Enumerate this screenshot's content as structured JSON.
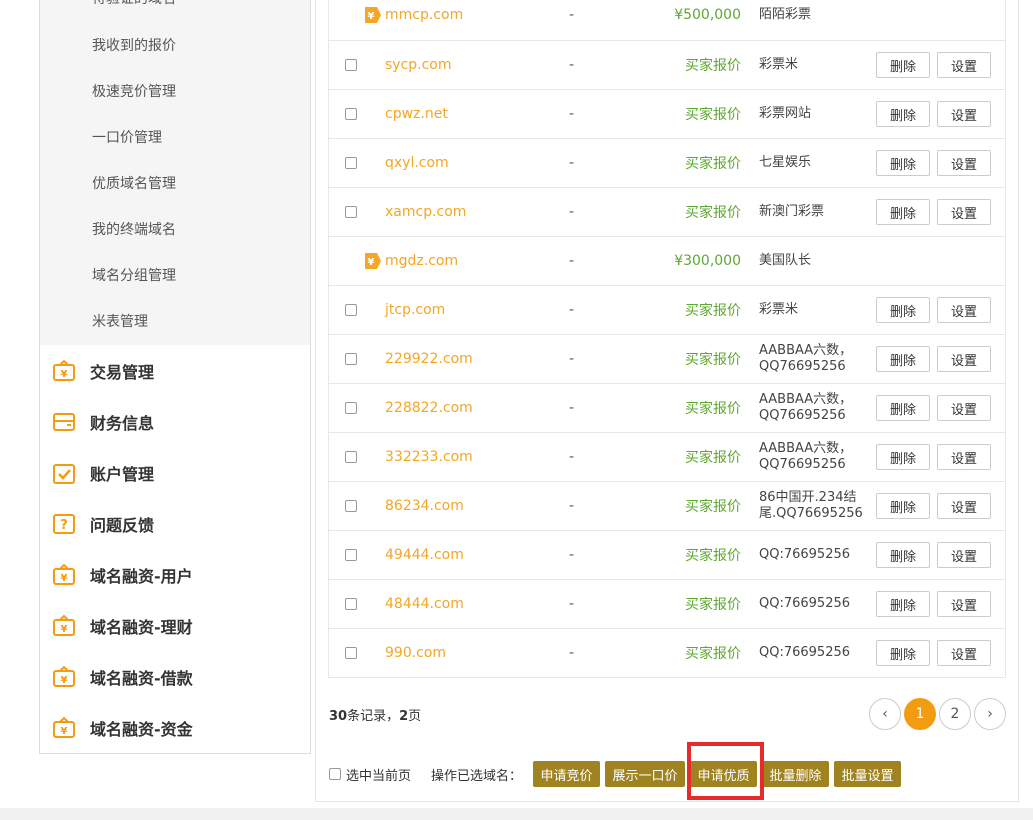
{
  "sidebar": {
    "sub_items": [
      "待验证的域名",
      "我收到的报价",
      "极速竞价管理",
      "一口价管理",
      "优质域名管理",
      "我的终端域名",
      "域名分组管理",
      "米表管理"
    ],
    "main_items": [
      {
        "label": "交易管理",
        "icon": "yen-bag-icon"
      },
      {
        "label": "财务信息",
        "icon": "card-icon"
      },
      {
        "label": "账户管理",
        "icon": "check-box-icon"
      },
      {
        "label": "问题反馈",
        "icon": "question-box-icon"
      },
      {
        "label": "域名融资-用户",
        "icon": "yen-bag-icon"
      },
      {
        "label": "域名融资-理财",
        "icon": "yen-bag-icon"
      },
      {
        "label": "域名融资-借款",
        "icon": "yen-bag-icon"
      },
      {
        "label": "域名融资-资金",
        "icon": "yen-bag-icon"
      }
    ]
  },
  "table": {
    "rows": [
      {
        "domain": "mmcp.com",
        "dash": "-",
        "price": "¥500,000",
        "desc": "陌陌彩票",
        "tagged": true,
        "has_actions": false
      },
      {
        "domain": "sycp.com",
        "dash": "-",
        "price": "买家报价",
        "desc": "彩票米",
        "tagged": false,
        "has_actions": true
      },
      {
        "domain": "cpwz.net",
        "dash": "-",
        "price": "买家报价",
        "desc": "彩票网站",
        "tagged": false,
        "has_actions": true
      },
      {
        "domain": "qxyl.com",
        "dash": "-",
        "price": "买家报价",
        "desc": "七星娱乐",
        "tagged": false,
        "has_actions": true
      },
      {
        "domain": "xamcp.com",
        "dash": "-",
        "price": "买家报价",
        "desc": "新澳门彩票",
        "tagged": false,
        "has_actions": true
      },
      {
        "domain": "mgdz.com",
        "dash": "-",
        "price": "¥300,000",
        "desc": "美国队长",
        "tagged": true,
        "has_actions": false
      },
      {
        "domain": "jtcp.com",
        "dash": "-",
        "price": "买家报价",
        "desc": "彩票米",
        "tagged": false,
        "has_actions": true
      },
      {
        "domain": "229922.com",
        "dash": "-",
        "price": "买家报价",
        "desc": "AABBAA六数，QQ76695256",
        "tagged": false,
        "has_actions": true
      },
      {
        "domain": "228822.com",
        "dash": "-",
        "price": "买家报价",
        "desc": "AABBAA六数，QQ76695256",
        "tagged": false,
        "has_actions": true
      },
      {
        "domain": "332233.com",
        "dash": "-",
        "price": "买家报价",
        "desc": "AABBAA六数，QQ76695256",
        "tagged": false,
        "has_actions": true
      },
      {
        "domain": "86234.com",
        "dash": "-",
        "price": "买家报价",
        "desc": "86中国开.234结尾.QQ76695256",
        "tagged": false,
        "has_actions": true
      },
      {
        "domain": "49444.com",
        "dash": "-",
        "price": "买家报价",
        "desc": "QQ:76695256",
        "tagged": false,
        "has_actions": true
      },
      {
        "domain": "48444.com",
        "dash": "-",
        "price": "买家报价",
        "desc": "QQ:76695256",
        "tagged": false,
        "has_actions": true
      },
      {
        "domain": "990.com",
        "dash": "-",
        "price": "买家报价",
        "desc": "QQ:76695256",
        "tagged": false,
        "has_actions": true
      }
    ],
    "delete_label": "删除",
    "settings_label": "设置"
  },
  "summary": {
    "count": "30",
    "count_suffix": "条记录，",
    "pages": "2",
    "pages_suffix": "页"
  },
  "pager": {
    "pages": [
      "1",
      "2"
    ],
    "active": "1",
    "prev": "‹",
    "next": "›"
  },
  "footer": {
    "select_page_label": "选中当前页",
    "operate_label": "操作已选域名：",
    "actions": [
      "申请竞价",
      "展示一口价",
      "申请优质",
      "批量删除",
      "批量设置"
    ]
  },
  "colors": {
    "accent": "#f39c12",
    "action_bg": "#a08321",
    "domain": "#f5a623",
    "price": "#5ea832",
    "highlight": "#e52b2b"
  }
}
